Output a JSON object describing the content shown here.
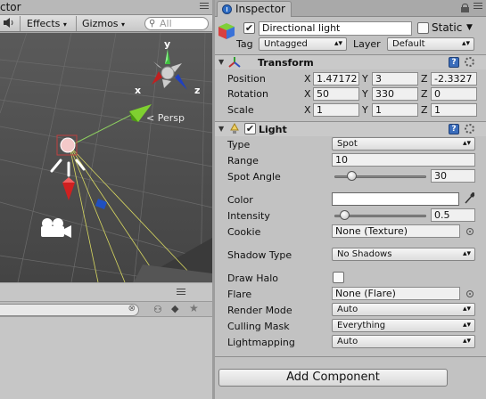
{
  "scene_panel": {
    "tab_title_fragment": "ctor",
    "toolbar": {
      "audio_icon": "speaker-icon",
      "effects_label": "Effects",
      "gizmos_label": "Gizmos",
      "search_placeholder": "All"
    },
    "persp_label": "Persp",
    "gizmo_axes": {
      "y": "y",
      "x": "x",
      "z": "z"
    }
  },
  "inspector": {
    "tab_label": "Inspector",
    "object": {
      "active": true,
      "name": "Directional light",
      "static_label": "Static",
      "static_checked": false,
      "tag_label": "Tag",
      "tag_value": "Untagged",
      "layer_label": "Layer",
      "layer_value": "Default"
    },
    "transform": {
      "title": "Transform",
      "position_label": "Position",
      "position": {
        "x": "1.47172",
        "y": "3",
        "z": "-2.3327"
      },
      "rotation_label": "Rotation",
      "rotation": {
        "x": "50",
        "y": "330",
        "z": "0"
      },
      "scale_label": "Scale",
      "scale": {
        "x": "1",
        "y": "1",
        "z": "1"
      },
      "axis_x": "X",
      "axis_y": "Y",
      "axis_z": "Z"
    },
    "light": {
      "title": "Light",
      "enabled": true,
      "type_label": "Type",
      "type_value": "Spot",
      "range_label": "Range",
      "range_value": "10",
      "spot_angle_label": "Spot Angle",
      "spot_angle_value": "30",
      "spot_angle_slider": 0.15,
      "color_label": "Color",
      "color_value": "#ffffff",
      "intensity_label": "Intensity",
      "intensity_value": "0.5",
      "intensity_slider": 0.06,
      "cookie_label": "Cookie",
      "cookie_value": "None (Texture)",
      "shadow_type_label": "Shadow Type",
      "shadow_type_value": "No Shadows",
      "draw_halo_label": "Draw Halo",
      "draw_halo_checked": false,
      "flare_label": "Flare",
      "flare_value": "None (Flare)",
      "render_mode_label": "Render Mode",
      "render_mode_value": "Auto",
      "culling_mask_label": "Culling Mask",
      "culling_mask_value": "Everything",
      "lightmapping_label": "Lightmapping",
      "lightmapping_value": "Auto"
    },
    "add_component_label": "Add Component"
  }
}
